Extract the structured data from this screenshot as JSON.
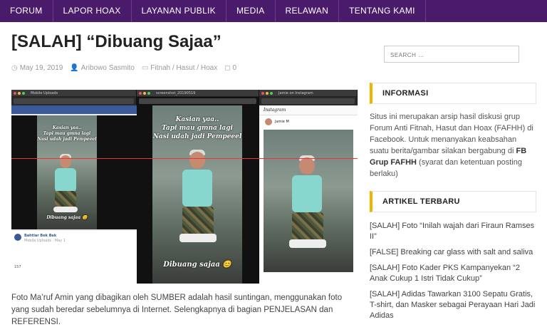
{
  "nav": {
    "items": [
      "FORUM",
      "LAPOR HOAX",
      "LAYANAN PUBLIK",
      "MEDIA",
      "RELAWAN",
      "TENTANG KAMI"
    ]
  },
  "post": {
    "title": "[SALAH] “Dibuang Sajaa”",
    "date": "May 19, 2019",
    "author": "Aribowo Sasmito",
    "category": "Fitnah / Hasut / Hoax",
    "comments": "0",
    "excerpt": "Foto Ma’ruf Amin yang dibagikan oleh SUMBER adalah hasil suntingan, menggunakan foto yang sudah beredar sebelumnya di Internet. Selengkapnya di bagian PENJELASAN dan REFERENSI."
  },
  "hero": {
    "tabs": [
      "Mobile Uploads",
      "Mobile Uploads",
      "screenshot_20190519",
      "Jamie on Instagram"
    ],
    "left_caption_1": "Kasian yaa..",
    "left_caption_2": "Tapi mau gmna lagi",
    "left_caption_3": "Nasi udah jadi Pempeeel",
    "left_bottom_caption": "Dibuang sajaa 😊",
    "mid_caption_1": "Kasian yaa..",
    "mid_caption_2": "Tapi mau gmna lagi",
    "mid_caption_3": "Nasi udah jadi Pempeeel",
    "mid_bottom_caption": "Dibuang sajaa 😊",
    "fb_name": "Bahtiar Bek Bek",
    "fb_sub": "Mobile Uploads · May 1",
    "fb_likes": "157",
    "ig_brand": "Instagram",
    "ig_user": "Jamie M",
    "colors": {
      "accent_red": "#e33333",
      "fb_blue": "#3b5998"
    }
  },
  "sidebar": {
    "search_placeholder": "SEARCH …",
    "info_title": "INFORMASI",
    "info_text_1": "Situs ini merupakan arsip hasil diskusi grup Forum Anti Fitnah, Hasut dan Hoax (FAFHH) di Facebook. Untuk menanyakan keabsahan suatu berita/gambar silakan bergabung di ",
    "info_link": "FB Grup FAFHH",
    "info_text_2": " (syarat dan ketentuan posting berlaku)",
    "articles_title": "ARTIKEL TERBARU",
    "articles": [
      "[SALAH] Foto “Inilah wajah dari Firaun Ramses II”",
      "[FALSE] Breaking car glass with salt and saliva",
      "[SALAH] Foto Kader PKS Kampanyekan “2 Anak Cukup 1 Istri Tidak Cukup”",
      "[SALAH] Adidas Tawarkan 3100 Sepatu Gratis, T-shirt, dan Masker sebagai Perayaan Hari Jadi Adidas"
    ]
  },
  "colors": {
    "nav_bg": "#4a1a6b",
    "widget_accent": "#f2b400"
  }
}
